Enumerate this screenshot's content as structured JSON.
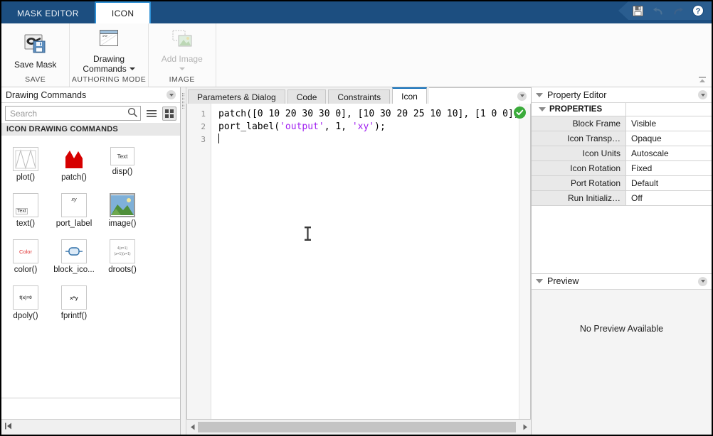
{
  "window": {
    "title": "Mask Editor"
  },
  "ribbon": {
    "tabs": [
      {
        "label": "MASK EDITOR",
        "active": false
      },
      {
        "label": "ICON",
        "active": true
      }
    ],
    "quick_access": [
      {
        "name": "save-icon",
        "label": "Save",
        "enabled": true
      },
      {
        "name": "undo-icon",
        "label": "Undo",
        "enabled": false
      },
      {
        "name": "redo-icon",
        "label": "Redo",
        "enabled": false
      },
      {
        "name": "help-icon",
        "label": "Help",
        "enabled": true
      }
    ],
    "groups": [
      {
        "label": "SAVE",
        "button": {
          "label": "Save Mask",
          "icon": "save-mask-icon",
          "enabled": true,
          "has_dropdown": false
        }
      },
      {
        "label": "AUTHORING MODE",
        "button": {
          "label": "Drawing\nCommands",
          "line1": "Drawing",
          "line2": "Commands",
          "icon": "drawing-commands-icon",
          "enabled": true,
          "has_dropdown": true
        }
      },
      {
        "label": "IMAGE",
        "button": {
          "label": "Add Image",
          "icon": "add-image-icon",
          "enabled": false,
          "has_dropdown": true
        }
      }
    ],
    "collapse_label": "Minimize"
  },
  "left_panel": {
    "title": "Drawing Commands",
    "search": {
      "placeholder": "Search",
      "value": ""
    },
    "view_list_label": "List view",
    "view_grid_label": "Grid view",
    "section_title": "ICON DRAWING COMMANDS",
    "commands": [
      {
        "label": "plot()",
        "icon": "plot-thumbnail"
      },
      {
        "label": "patch()",
        "icon": "patch-thumbnail"
      },
      {
        "label": "disp()",
        "icon": "disp-thumbnail",
        "glyph": "Text"
      },
      {
        "label": "text()",
        "icon": "text-thumbnail",
        "glyph": "Text"
      },
      {
        "label": "port_label",
        "icon": "port-label-thumbnail",
        "glyph": "xy"
      },
      {
        "label": "image()",
        "icon": "image-thumbnail"
      },
      {
        "label": "color()",
        "icon": "color-thumbnail",
        "glyph": "Color"
      },
      {
        "label": "block_ico...",
        "icon": "block-icon-thumbnail"
      },
      {
        "label": "droots()",
        "icon": "droots-thumbnail"
      },
      {
        "label": "dpoly()",
        "icon": "dpoly-thumbnail",
        "glyph": "f(x)=0"
      },
      {
        "label": "fprintf()",
        "icon": "fprintf-thumbnail",
        "glyph": "x*y"
      }
    ],
    "collapse_label": "Collapse panel"
  },
  "editor": {
    "tabs": [
      {
        "label": "Parameters & Dialog",
        "active": false
      },
      {
        "label": "Code",
        "active": false
      },
      {
        "label": "Constraints",
        "active": false
      },
      {
        "label": "Icon",
        "active": true
      }
    ],
    "line_numbers": [
      "1",
      "2",
      "3"
    ],
    "code": {
      "line1_a": "patch([0 10 20 30 30 0], [10 30 20 25 10 10], [1 0 0]);",
      "line2_a": "port_label(",
      "line2_str1": "'output'",
      "line2_b": ", 1, ",
      "line2_str2": "'xy'",
      "line2_c": ");",
      "line3": ""
    },
    "status_icon": "check-circle-icon",
    "status_label": "No syntax errors",
    "hscroll_left_label": "Scroll left",
    "hscroll_right_label": "Scroll right"
  },
  "property_editor": {
    "title": "Property Editor",
    "section": "PROPERTIES",
    "rows": [
      {
        "key": "Block Frame",
        "value": "Visible"
      },
      {
        "key": "Icon Transp…",
        "value": "Opaque"
      },
      {
        "key": "Icon Units",
        "value": "Autoscale"
      },
      {
        "key": "Icon Rotation",
        "value": "Fixed"
      },
      {
        "key": "Port Rotation",
        "value": "Default"
      },
      {
        "key": "Run Initializ…",
        "value": "Off"
      }
    ]
  },
  "preview": {
    "title": "Preview",
    "message": "No Preview Available"
  },
  "colors": {
    "ribbon_blue": "#1c4e80",
    "tab_accent": "#2e8fd4",
    "active_tab_underline": "#0b6cb8",
    "string_purple": "#a020f0",
    "status_green": "#3aab3a",
    "patch_red": "#d60000"
  }
}
